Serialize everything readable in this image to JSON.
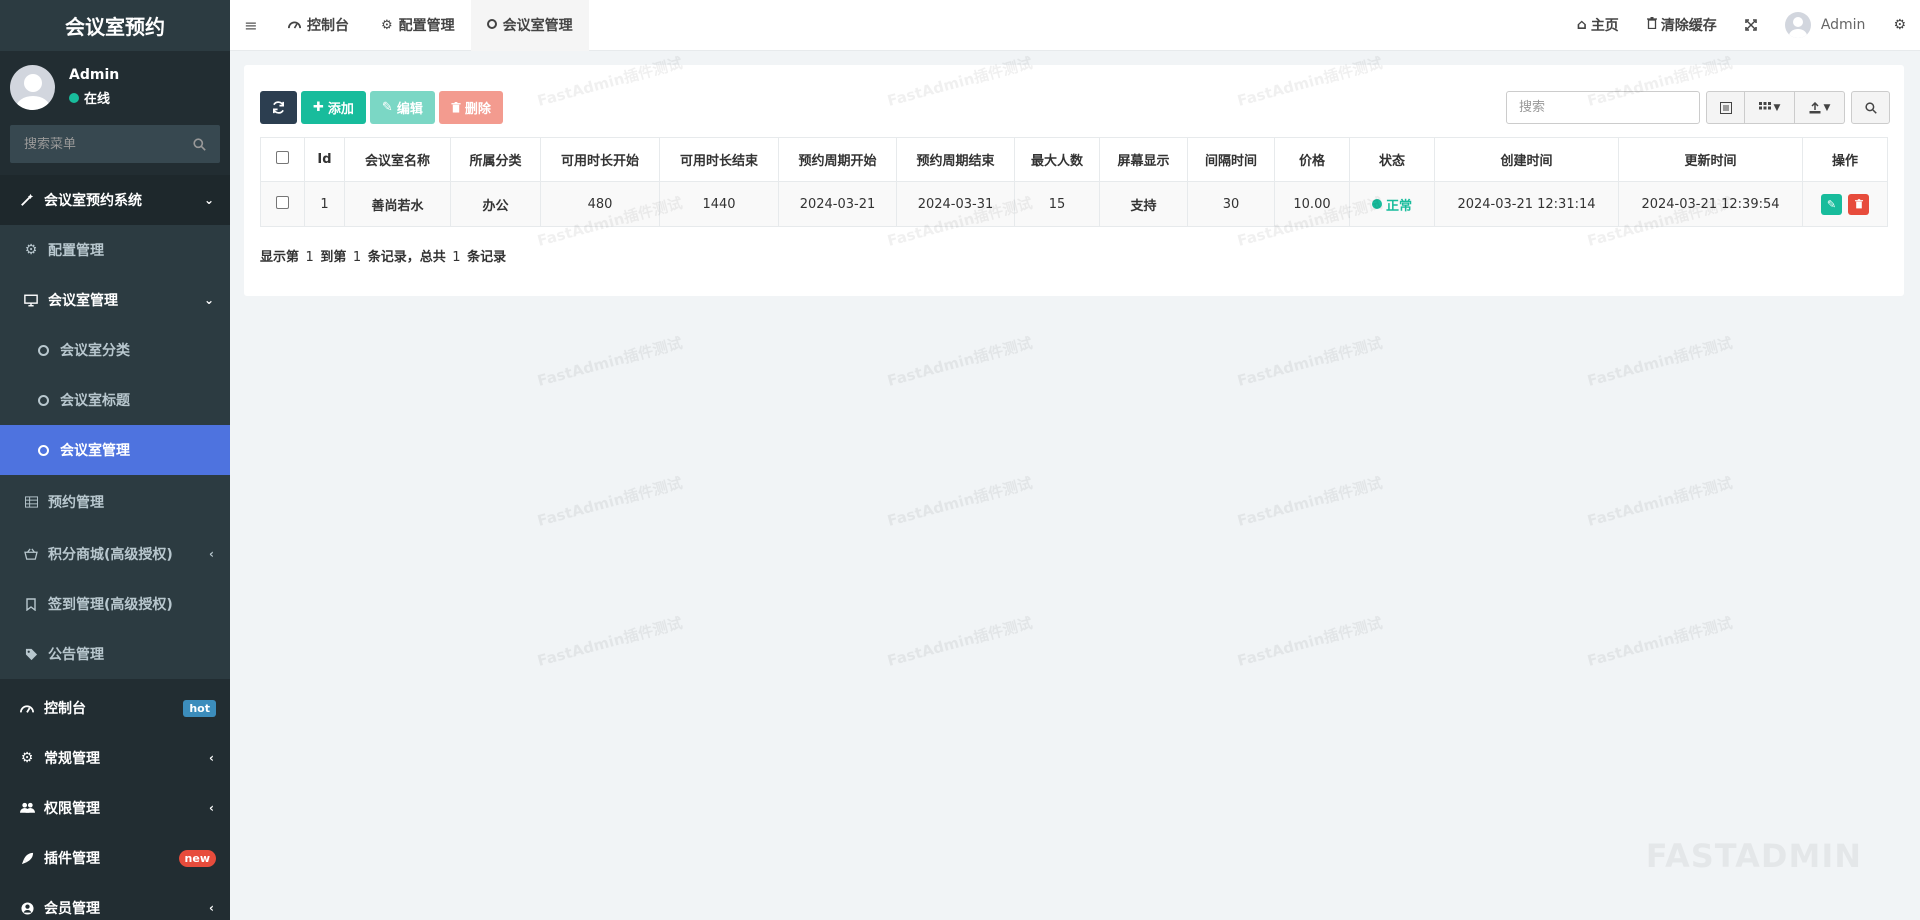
{
  "app": {
    "title": "会议室预约"
  },
  "user": {
    "name": "Admin",
    "status": "在线"
  },
  "sidebar": {
    "search_placeholder": "搜索菜单",
    "items": [
      {
        "label": "会议室预约系统",
        "icon": "magic-wand-icon",
        "level": "top",
        "caret": "down"
      },
      {
        "label": "配置管理",
        "icon": "gear-icon",
        "level": "sub"
      },
      {
        "label": "会议室管理",
        "icon": "monitor-icon",
        "level": "sub",
        "caret": "down"
      },
      {
        "label": "会议室分类",
        "icon": "circle-icon",
        "level": "subsub"
      },
      {
        "label": "会议室标题",
        "icon": "circle-icon",
        "level": "subsub"
      },
      {
        "label": "会议室管理",
        "icon": "circle-icon",
        "level": "subsub",
        "active": true
      },
      {
        "label": "预约管理",
        "icon": "table-icon",
        "level": "sub"
      },
      {
        "label": "积分商城(高级授权)",
        "icon": "basket-icon",
        "level": "sub",
        "caret": "left"
      },
      {
        "label": "签到管理(高级授权)",
        "icon": "bookmark-icon",
        "level": "sub"
      },
      {
        "label": "公告管理",
        "icon": "tag-icon",
        "level": "sub"
      },
      {
        "label": "控制台",
        "icon": "dashboard-icon",
        "level": "main",
        "badge": "hot"
      },
      {
        "label": "常规管理",
        "icon": "cogs-icon",
        "level": "main",
        "caret": "left"
      },
      {
        "label": "权限管理",
        "icon": "users-icon",
        "level": "main",
        "caret": "left"
      },
      {
        "label": "插件管理",
        "icon": "rocket-icon",
        "level": "main",
        "badge": "new"
      },
      {
        "label": "会员管理",
        "icon": "user-circle-icon",
        "level": "main",
        "caret": "left"
      }
    ]
  },
  "header": {
    "tabs": [
      {
        "label": "控制台",
        "icon": "dashboard-icon"
      },
      {
        "label": "配置管理",
        "icon": "gear-icon"
      },
      {
        "label": "会议室管理",
        "icon": "circle-icon",
        "active": true
      }
    ],
    "right": {
      "home": "主页",
      "clear_cache": "清除缓存",
      "user": "Admin"
    }
  },
  "toolbar": {
    "add": "添加",
    "edit": "编辑",
    "delete": "删除",
    "search_placeholder": "搜索"
  },
  "table": {
    "columns": [
      "Id",
      "会议室名称",
      "所属分类",
      "可用时长开始",
      "可用时长结束",
      "预约周期开始",
      "预约周期结束",
      "最大人数",
      "屏幕显示",
      "间隔时间",
      "价格",
      "状态",
      "创建时间",
      "更新时间",
      "操作"
    ],
    "rows": [
      {
        "id": "1",
        "name": "善尚若水",
        "category": "办公",
        "avail_start": "480",
        "avail_end": "1440",
        "period_start": "2024-03-21",
        "period_end": "2024-03-31",
        "max_people": "15",
        "screen": "支持",
        "interval": "30",
        "price": "10.00",
        "status": "正常",
        "created": "2024-03-21 12:31:14",
        "updated": "2024-03-21 12:39:54"
      }
    ]
  },
  "pager": {
    "p1": "显示第",
    "from": "1",
    "p2": "到第",
    "to": "1",
    "p3": "条记录，总共",
    "total": "1",
    "p4": "条记录"
  },
  "watermark": "FastAdmin插件测试",
  "brand_watermark": "FASTADMIN",
  "colors": {
    "accent": "#4e73df",
    "success": "#18bc9c",
    "danger": "#e74c3c",
    "sidebar_bg": "#222d32"
  }
}
